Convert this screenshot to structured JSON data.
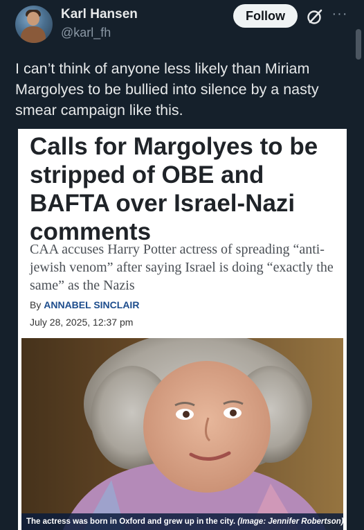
{
  "author": {
    "display_name": "Karl Hansen",
    "handle": "@karl_fh",
    "follow_label": "Follow",
    "more_label": "···"
  },
  "icons": {
    "grok": "grok-icon",
    "more": "more-icon"
  },
  "tweet": {
    "text": "I can’t think of anyone less likely than Miriam Margolyes to be bullied into silence by a nasty smear campaign like this."
  },
  "article": {
    "headline": "Calls for Margolyes to be stripped of OBE and BAFTA over Israel-Nazi comments",
    "subhead": "CAA accuses Harry Potter actress of spreading “anti- jewish venom” after saying Israel is doing “exactly the same” as the Nazis",
    "byline_prefix": "By",
    "byline_author": "ANNABEL SINCLAIR",
    "date": "July 28, 2025, 12:37 pm",
    "caption": "The actress was born in Oxford and grew up in the city.",
    "caption_credit": "(Image: Jennifer Robertson)"
  },
  "colors": {
    "background": "#15202b",
    "text_primary": "#e7e9ea",
    "text_secondary": "#8b98a5",
    "follow_bg": "#eff3f4",
    "byline_author": "#1c4c8c"
  }
}
